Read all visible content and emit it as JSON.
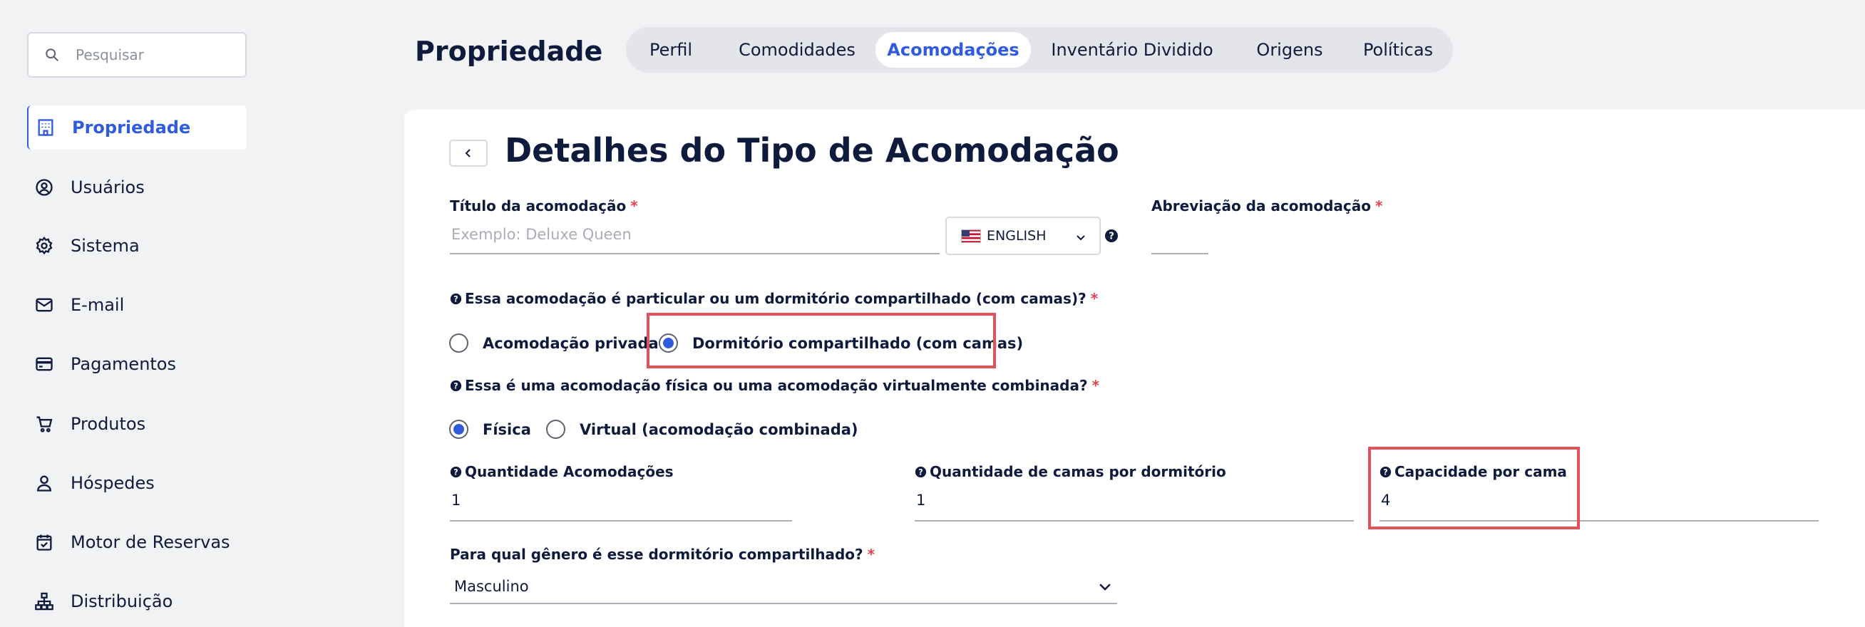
{
  "sidebar": {
    "search_placeholder": "Pesquisar",
    "items": [
      {
        "label": "Propriedade",
        "icon": "building-icon",
        "active": true
      },
      {
        "label": "Usuários",
        "icon": "user-circle-icon"
      },
      {
        "label": "Sistema",
        "icon": "gear-icon"
      },
      {
        "label": "E-mail",
        "icon": "mail-icon"
      },
      {
        "label": "Pagamentos",
        "icon": "credit-card-icon"
      },
      {
        "label": "Produtos",
        "icon": "cart-icon"
      },
      {
        "label": "Hóspedes",
        "icon": "user-icon"
      },
      {
        "label": "Motor de Reservas",
        "icon": "calendar-check-icon"
      },
      {
        "label": "Distribuição",
        "icon": "network-icon"
      }
    ]
  },
  "header": {
    "title": "Propriedade",
    "tabs": [
      {
        "label": "Perfil"
      },
      {
        "label": "Comodidades"
      },
      {
        "label": "Acomodações",
        "active": true
      },
      {
        "label": "Inventário Dividido"
      },
      {
        "label": "Origens"
      },
      {
        "label": "Políticas"
      }
    ]
  },
  "form": {
    "title": "Detalhes do Tipo de Acomodação",
    "room_title": {
      "label": "Título da acomodação",
      "required_mark": "*",
      "placeholder": "Exemplo: Deluxe Queen"
    },
    "language": {
      "value": "ENGLISH",
      "flag": "us-flag-icon"
    },
    "abbreviation": {
      "label": "Abreviação da acomodação",
      "required_mark": "*",
      "value": ""
    },
    "room_kind": {
      "question": "Essa acomodação é particular ou um dormitório compartilhado (com camas)?",
      "required_mark": "*",
      "options": [
        "Acomodação privada",
        "Dormitório compartilhado (com camas)"
      ],
      "selected": 1
    },
    "physical_virtual": {
      "question": "Essa é uma acomodação física ou uma acomodação virtualmente combinada?",
      "required_mark": "*",
      "options": [
        "Física",
        "Virtual (acomodação combinada)"
      ],
      "selected": 0
    },
    "rooms_qty": {
      "label": "Quantidade Acomodações",
      "value": "1"
    },
    "beds_per_dorm": {
      "label": "Quantidade de camas por dormitório",
      "value": "1"
    },
    "capacity_per_bed": {
      "label": "Capacidade por cama",
      "value": "4"
    },
    "gender": {
      "question": "Para qual gênero é esse dormitório compartilhado?",
      "required_mark": "*",
      "value": "Masculino"
    }
  },
  "colors": {
    "accent": "#2f5bdc",
    "highlight": "#e4515b",
    "required": "#e0434f",
    "background": "#f1f2f4",
    "text": "#0f1b3d"
  }
}
